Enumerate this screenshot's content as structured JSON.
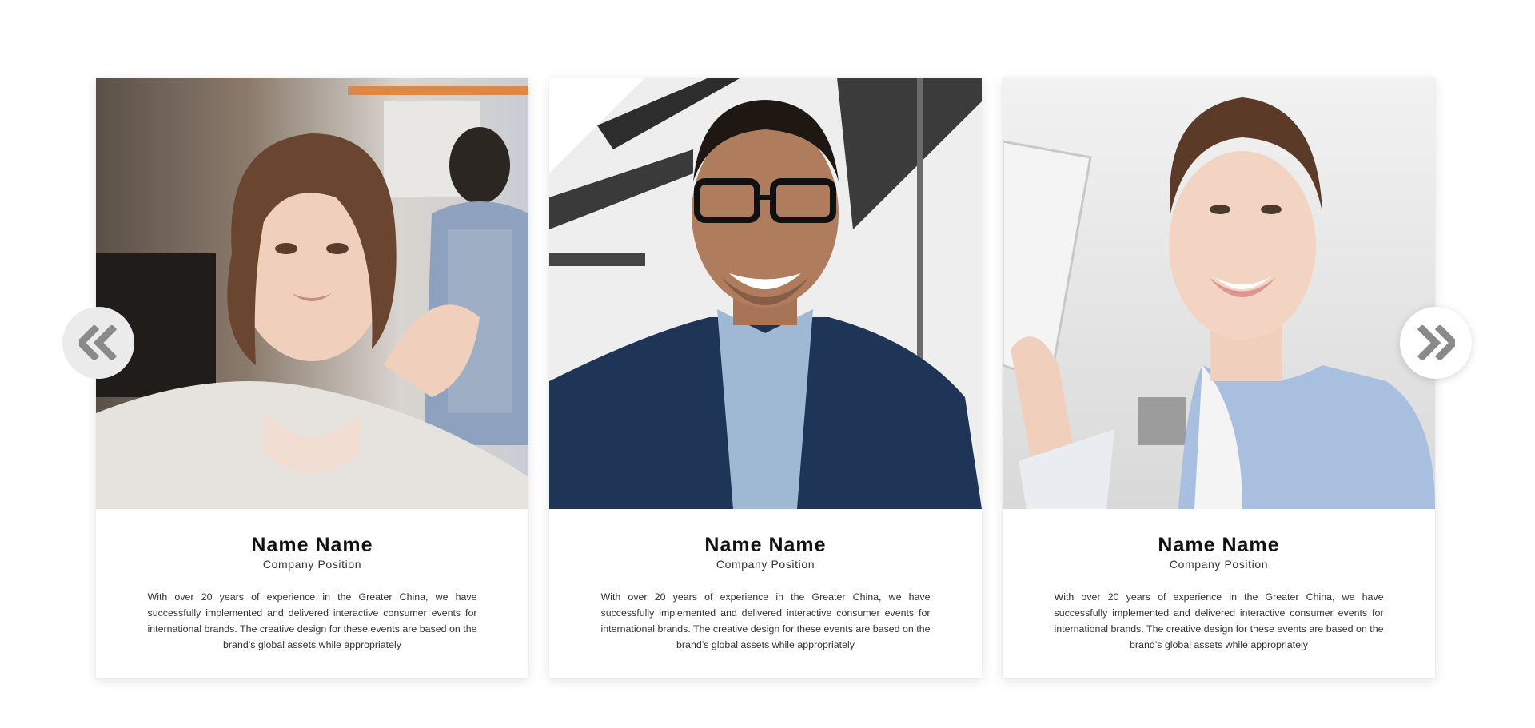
{
  "carousel": {
    "prev_icon": "double-chevron-left-icon",
    "next_icon": "double-chevron-right-icon",
    "cards": [
      {
        "name": "Name Name",
        "position": "Company Position",
        "bio": "With over 20 years of experience in the Greater China, we have successfully implemented and delivered interactive consumer events for international brands. The creative design for these events are based on the brand’s global assets while appropriately",
        "photo": "portrait-woman-office"
      },
      {
        "name": "Name Name",
        "position": "Company Position",
        "bio": "With over 20 years of experience in the Greater China, we have successfully implemented and delivered interactive consumer events for international brands. The creative design for these events are based on the brand’s global assets while appropriately",
        "photo": "portrait-man-glasses"
      },
      {
        "name": "Name Name",
        "position": "Company Position",
        "bio": "With over 20 years of experience in the Greater China, we have successfully implemented and delivered interactive consumer events for international brands. The creative design for these events are based on the brand’s global assets while appropriately",
        "photo": "portrait-woman-smiling"
      }
    ]
  },
  "colors": {
    "background": "#ffffff",
    "arrow": "#8a8a8a",
    "prev_button_bg": "#ebebeb",
    "next_button_bg": "#ffffff"
  }
}
